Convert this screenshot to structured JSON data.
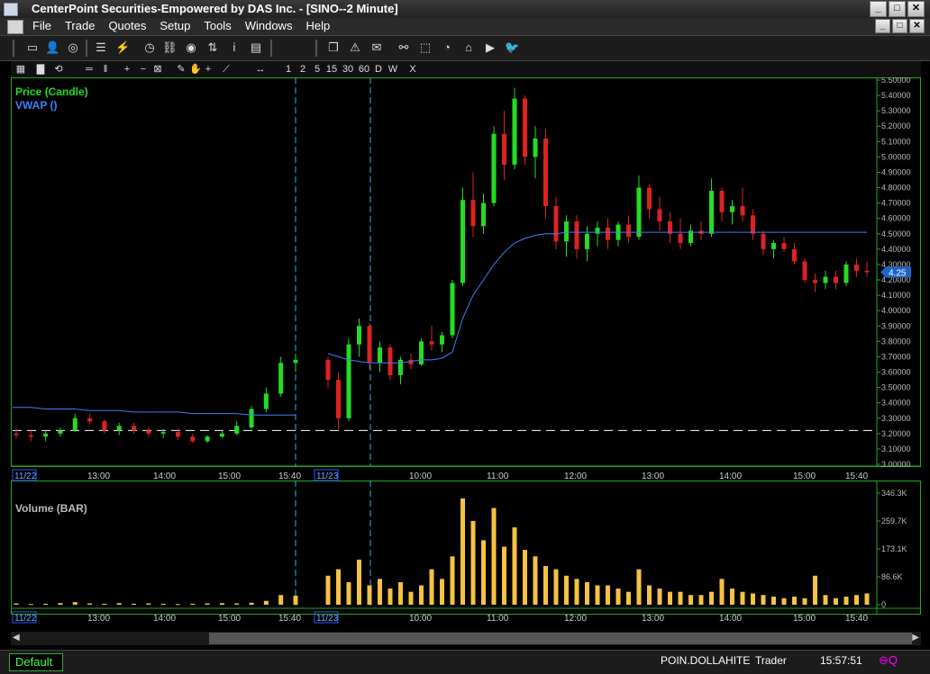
{
  "window": {
    "title": "CenterPoint Securities-Empowered by DAS Inc. - [SINO--2 Minute]",
    "buttons": {
      "minimize": "_",
      "maximize": "□",
      "close": "✕"
    }
  },
  "menu": {
    "items": [
      {
        "label": "File"
      },
      {
        "label": "Trade"
      },
      {
        "label": "Quotes"
      },
      {
        "label": "Setup"
      },
      {
        "label": "Tools"
      },
      {
        "label": "Windows"
      },
      {
        "label": "Help"
      }
    ]
  },
  "toolbar": {
    "icons": [
      "window-icon",
      "person-icon",
      "globe-icon",
      "list-icon",
      "lightning-icon",
      "clock-icon",
      "link-icon",
      "eye-icon",
      "sort-icon",
      "info-icon",
      "chart-icon",
      "copy-icon",
      "alert-icon",
      "mail-icon",
      "binoculars-icon",
      "select-icon",
      "time-icon",
      "home-icon",
      "youtube-icon",
      "twitter-icon"
    ],
    "glyphs": [
      "▭",
      "👤",
      "◎",
      "☰",
      "⚡",
      "◷",
      "⛓",
      "◉",
      "⇅",
      "i",
      "▤",
      "❐",
      "⚠",
      "✉",
      "⚯",
      "⬚",
      "◔",
      "⌂",
      "▶",
      "🐦"
    ]
  },
  "chart_toolbar": {
    "timeframes": [
      "1",
      "2",
      "5",
      "15",
      "30",
      "60",
      "D",
      "W",
      "X"
    ],
    "tools": [
      "▦",
      "▇",
      "⟲",
      "═",
      "‖",
      "+",
      "−",
      "⊠",
      "✎",
      "✋",
      "+",
      "⟋",
      "↔"
    ]
  },
  "symbol": "SINO",
  "price_panel": {
    "legend": [
      {
        "label": "Price (Candle)",
        "color": "#22dd22"
      },
      {
        "label": "VWAP ()",
        "color": "#3f7fff"
      }
    ],
    "last_price_tag": "4.25",
    "date_tags": [
      "11/22",
      "11/23"
    ]
  },
  "volume_panel": {
    "legend": "Volume (BAR)",
    "date_tags": [
      "11/22",
      "11/23"
    ]
  },
  "colors": {
    "up": "#22dd22",
    "down": "#dd2222",
    "vwap": "#3f7fff",
    "volume": "#f5c242",
    "axis": "#22aa22",
    "session_line": "#29b6d6",
    "ref_line": "#ffffff"
  },
  "chart_data": [
    {
      "type": "candlestick",
      "title": "Price (Candle)",
      "symbol": "SINO",
      "interval": "2 Minute",
      "y_ticks": [
        "3.00000",
        "3.10000",
        "3.20000",
        "3.30000",
        "3.40000",
        "3.50000",
        "3.60000",
        "3.70000",
        "3.80000",
        "3.90000",
        "4.00000",
        "4.10000",
        "4.20000",
        "4.30000",
        "4.40000",
        "4.50000",
        "4.60000",
        "4.70000",
        "4.80000",
        "4.90000",
        "5.00000",
        "5.10000",
        "5.20000",
        "5.30000",
        "5.40000",
        "5.50000"
      ],
      "ylim": [
        3.0,
        5.5
      ],
      "x_ticks": [
        "11/22",
        "13:00",
        "14:00",
        "15:00",
        "15:40",
        "11/23",
        "10:00",
        "11:00",
        "12:00",
        "13:00",
        "14:00",
        "15:00",
        "15:40"
      ],
      "reference_line": 3.22,
      "last_price": 4.25,
      "series": [
        {
          "name": "Price (Candle)",
          "type": "candlestick",
          "fields": [
            "open",
            "high",
            "low",
            "close"
          ],
          "values": [
            [
              3.2,
              3.23,
              3.17,
              3.19
            ],
            [
              3.19,
              3.22,
              3.15,
              3.18
            ],
            [
              3.18,
              3.22,
              3.15,
              3.2
            ],
            [
              3.2,
              3.24,
              3.18,
              3.22
            ],
            [
              3.22,
              3.33,
              3.21,
              3.3
            ],
            [
              3.3,
              3.33,
              3.26,
              3.28
            ],
            [
              3.28,
              3.29,
              3.2,
              3.22
            ],
            [
              3.22,
              3.27,
              3.19,
              3.25
            ],
            [
              3.25,
              3.27,
              3.2,
              3.22
            ],
            [
              3.22,
              3.24,
              3.18,
              3.2
            ],
            [
              3.2,
              3.23,
              3.17,
              3.21
            ],
            [
              3.21,
              3.23,
              3.16,
              3.18
            ],
            [
              3.18,
              3.2,
              3.14,
              3.15
            ],
            [
              3.15,
              3.19,
              3.14,
              3.18
            ],
            [
              3.18,
              3.22,
              3.17,
              3.2
            ],
            [
              3.2,
              3.28,
              3.19,
              3.25
            ],
            [
              3.24,
              3.38,
              3.23,
              3.36
            ],
            [
              3.36,
              3.5,
              3.34,
              3.46
            ],
            [
              3.46,
              3.7,
              3.44,
              3.66
            ],
            [
              3.66,
              3.72,
              3.6,
              3.68
            ],
            [
              3.68,
              3.7,
              3.5,
              3.55
            ],
            [
              3.55,
              3.6,
              3.23,
              3.3
            ],
            [
              3.3,
              3.82,
              3.28,
              3.78
            ],
            [
              3.78,
              3.95,
              3.7,
              3.9
            ],
            [
              3.9,
              3.92,
              3.62,
              3.66
            ],
            [
              3.66,
              3.8,
              3.6,
              3.76
            ],
            [
              3.76,
              3.78,
              3.55,
              3.58
            ],
            [
              3.58,
              3.7,
              3.52,
              3.68
            ],
            [
              3.68,
              3.72,
              3.62,
              3.65
            ],
            [
              3.65,
              3.82,
              3.64,
              3.8
            ],
            [
              3.8,
              3.9,
              3.74,
              3.78
            ],
            [
              3.78,
              3.86,
              3.73,
              3.84
            ],
            [
              3.84,
              4.2,
              3.82,
              4.18
            ],
            [
              4.18,
              4.8,
              4.16,
              4.72
            ],
            [
              4.72,
              4.9,
              4.48,
              4.55
            ],
            [
              4.55,
              4.76,
              4.5,
              4.7
            ],
            [
              4.7,
              5.2,
              4.68,
              5.15
            ],
            [
              5.15,
              5.3,
              4.85,
              4.95
            ],
            [
              4.95,
              5.45,
              4.92,
              5.38
            ],
            [
              5.38,
              5.4,
              4.95,
              5.0
            ],
            [
              5.0,
              5.2,
              4.86,
              5.12
            ],
            [
              5.12,
              5.18,
              4.6,
              4.68
            ],
            [
              4.68,
              4.74,
              4.4,
              4.45
            ],
            [
              4.45,
              4.62,
              4.35,
              4.58
            ],
            [
              4.58,
              4.62,
              4.34,
              4.4
            ],
            [
              4.4,
              4.55,
              4.32,
              4.5
            ],
            [
              4.5,
              4.58,
              4.42,
              4.54
            ],
            [
              4.54,
              4.6,
              4.4,
              4.46
            ],
            [
              4.46,
              4.58,
              4.42,
              4.56
            ],
            [
              4.56,
              4.62,
              4.44,
              4.48
            ],
            [
              4.48,
              4.88,
              4.46,
              4.8
            ],
            [
              4.8,
              4.82,
              4.6,
              4.66
            ],
            [
              4.66,
              4.74,
              4.52,
              4.58
            ],
            [
              4.58,
              4.64,
              4.44,
              4.5
            ],
            [
              4.5,
              4.6,
              4.4,
              4.44
            ],
            [
              4.44,
              4.56,
              4.42,
              4.52
            ],
            [
              4.52,
              4.58,
              4.46,
              4.5
            ],
            [
              4.5,
              4.86,
              4.48,
              4.78
            ],
            [
              4.78,
              4.8,
              4.58,
              4.64
            ],
            [
              4.64,
              4.72,
              4.56,
              4.68
            ],
            [
              4.68,
              4.8,
              4.58,
              4.62
            ],
            [
              4.62,
              4.66,
              4.46,
              4.5
            ],
            [
              4.5,
              4.52,
              4.36,
              4.4
            ],
            [
              4.4,
              4.46,
              4.34,
              4.44
            ],
            [
              4.44,
              4.48,
              4.38,
              4.4
            ],
            [
              4.4,
              4.44,
              4.3,
              4.32
            ],
            [
              4.32,
              4.34,
              4.18,
              4.2
            ],
            [
              4.2,
              4.24,
              4.12,
              4.18
            ],
            [
              4.18,
              4.26,
              4.14,
              4.22
            ],
            [
              4.22,
              4.26,
              4.14,
              4.18
            ],
            [
              4.18,
              4.32,
              4.16,
              4.3
            ],
            [
              4.3,
              4.34,
              4.22,
              4.26
            ],
            [
              4.26,
              4.32,
              4.22,
              4.25
            ]
          ]
        },
        {
          "name": "VWAP ()",
          "type": "line",
          "values": [
            3.37,
            3.37,
            3.36,
            3.36,
            3.36,
            3.35,
            3.35,
            3.35,
            3.34,
            3.34,
            3.34,
            3.34,
            3.33,
            3.33,
            3.33,
            3.33,
            3.32,
            3.32,
            3.32,
            3.32,
            3.72,
            3.7,
            3.68,
            3.67,
            3.66,
            3.66,
            3.66,
            3.66,
            3.67,
            3.68,
            3.68,
            3.69,
            3.73,
            3.95,
            4.1,
            4.2,
            4.3,
            4.38,
            4.44,
            4.47,
            4.49,
            4.5,
            4.5,
            4.51,
            4.51,
            4.51,
            4.51,
            4.51,
            4.51,
            4.51,
            4.51,
            4.51,
            4.51,
            4.51,
            4.51,
            4.51,
            4.51,
            4.51,
            4.51,
            4.51,
            4.51,
            4.51,
            4.51,
            4.51,
            4.51,
            4.51,
            4.51,
            4.51,
            4.51,
            4.51,
            4.51,
            4.51,
            4.51
          ]
        }
      ]
    },
    {
      "type": "bar",
      "title": "Volume (BAR)",
      "y_ticks": [
        "0",
        "86.6K",
        "173.1K",
        "259.7K",
        "346.3K"
      ],
      "ylim": [
        0,
        346300
      ],
      "series": [
        {
          "name": "Volume",
          "values": [
            4000,
            2000,
            3000,
            5000,
            8000,
            4000,
            3000,
            5000,
            3000,
            4000,
            3000,
            2000,
            3000,
            4000,
            5000,
            4000,
            6000,
            12000,
            30000,
            28000,
            90000,
            110000,
            70000,
            140000,
            60000,
            80000,
            50000,
            70000,
            40000,
            60000,
            110000,
            80000,
            150000,
            330000,
            260000,
            200000,
            300000,
            180000,
            240000,
            170000,
            150000,
            120000,
            110000,
            90000,
            80000,
            70000,
            60000,
            60000,
            50000,
            40000,
            110000,
            60000,
            50000,
            40000,
            40000,
            30000,
            30000,
            40000,
            80000,
            50000,
            40000,
            35000,
            30000,
            25000,
            20000,
            25000,
            20000,
            90000,
            30000,
            20000,
            25000,
            30000,
            35000
          ]
        }
      ]
    }
  ],
  "status": {
    "tab": "Default",
    "user": "POIN.DOLLAHITE",
    "role": "Trader",
    "time": "15:57:51"
  }
}
